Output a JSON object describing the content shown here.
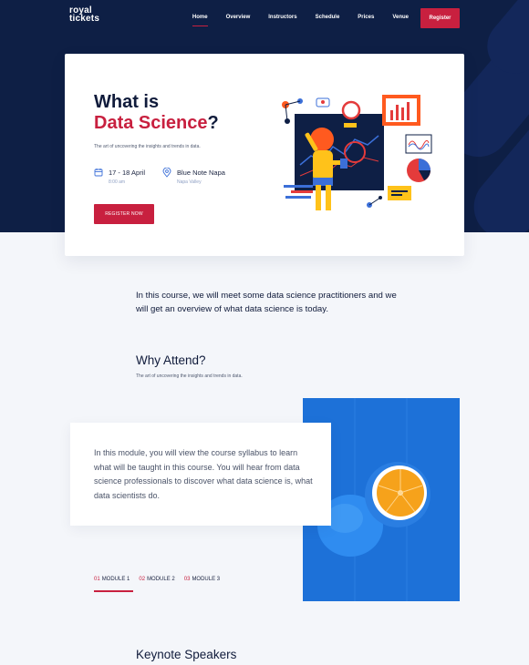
{
  "brand": {
    "logo_line1": "royal",
    "logo_line2": "tickets"
  },
  "nav": {
    "items": [
      "Home",
      "Overview",
      "Instructors",
      "Schedule",
      "Prices",
      "Venue"
    ],
    "register": "Register"
  },
  "hero": {
    "title_line1": "What is",
    "title_highlight": "Data Science",
    "title_suffix": "?",
    "subtitle": "The art of uncovering the insights and trends in data.",
    "date": "17 - 18 April",
    "time": "8:00 am",
    "venue": "Blue Note Napa",
    "location": "Napa Valley",
    "button": "REGISTER NOW"
  },
  "intro": "In this course, we will meet some data science practitioners and we will get an overview of what data science is today.",
  "why": {
    "title": "Why Attend?",
    "subtitle": "The art of uncovering the insights and trends in data."
  },
  "module": {
    "text": "In this module, you will view the course syllabus to learn what will be taught in this course. You will hear from data science professionals to discover what data science is, what data scientists do."
  },
  "tabs": [
    {
      "num": "01",
      "label": "MODULE 1"
    },
    {
      "num": "02",
      "label": "MODULE 2"
    },
    {
      "num": "03",
      "label": "MODULE 3"
    }
  ],
  "speakers_title": "Keynote Speakers",
  "colors": {
    "navy": "#0e1f45",
    "accent": "#c8203f",
    "photo_blue": "#1d71d8"
  },
  "icons": [
    "calendar-icon",
    "location-pin-icon"
  ]
}
